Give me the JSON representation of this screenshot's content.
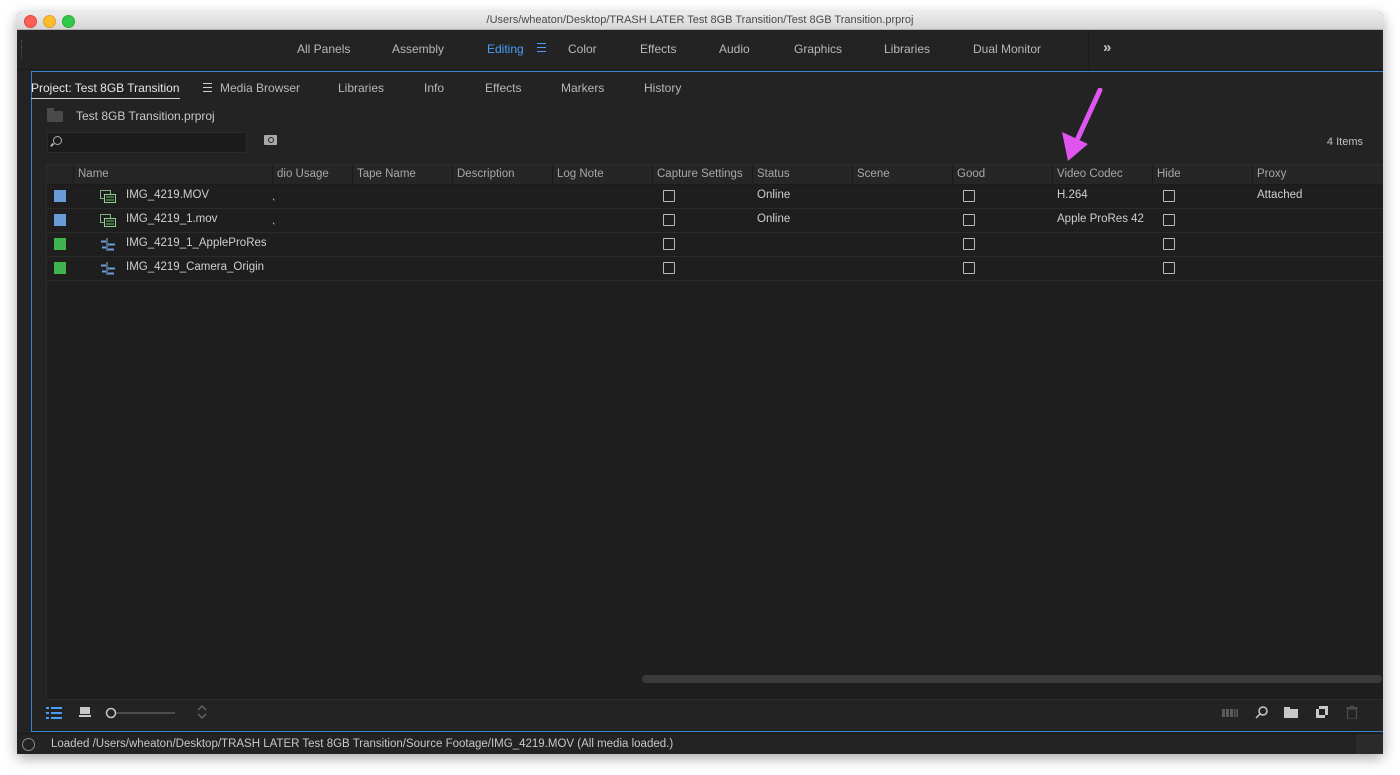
{
  "window": {
    "title": "/Users/wheaton/Desktop/TRASH LATER Test 8GB Transition/Test 8GB Transition.prproj"
  },
  "workspaces": {
    "items": [
      "All Panels",
      "Assembly",
      "Editing",
      "Color",
      "Effects",
      "Audio",
      "Graphics",
      "Libraries",
      "Dual Monitor"
    ],
    "active": "Editing",
    "overflow": "»"
  },
  "panel": {
    "tabs": [
      "Project: Test 8GB Transition",
      "Media Browser",
      "Libraries",
      "Info",
      "Effects",
      "Markers",
      "History"
    ],
    "active_tab": "Project: Test 8GB Transition",
    "project_file": "Test 8GB Transition.prproj",
    "search_value": "",
    "items_count": "4 Items"
  },
  "table": {
    "columns": [
      "Name",
      "dio Usage",
      "Tape Name",
      "Description",
      "Log Note",
      "Capture Settings",
      "Status",
      "Scene",
      "Good",
      "Video Codec",
      "Hide",
      "Proxy"
    ],
    "rows": [
      {
        "label_color": "#6b9bd6",
        "icon": "video-clip-icon",
        "name": "IMG_4219.MOV",
        "audio_usage": "ˎ",
        "status": "Online",
        "video_codec": "H.264",
        "proxy": "Attached"
      },
      {
        "label_color": "#6b9bd6",
        "icon": "video-clip-icon",
        "name": "IMG_4219_1.mov",
        "audio_usage": "ˎ",
        "status": "Online",
        "video_codec": "Apple ProRes 42",
        "proxy": ""
      },
      {
        "label_color": "#3fb34f",
        "icon": "sequence-icon",
        "name": "IMG_4219_1_AppleProRes",
        "audio_usage": "",
        "status": "",
        "video_codec": "",
        "proxy": ""
      },
      {
        "label_color": "#3fb34f",
        "icon": "sequence-icon",
        "name": "IMG_4219_Camera_Origin",
        "audio_usage": "",
        "status": "",
        "video_codec": "",
        "proxy": ""
      }
    ]
  },
  "status_bar": {
    "text": "Loaded  /Users/wheaton/Desktop/TRASH LATER Test 8GB Transition/Source Footage/IMG_4219.MOV (All media loaded.)"
  },
  "colors": {
    "accent": "#4a9df8",
    "annotation_arrow": "#e055f0",
    "panel_border": "#3a7fd0"
  }
}
